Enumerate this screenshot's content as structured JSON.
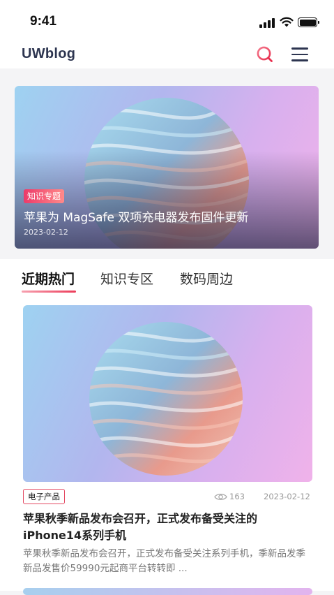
{
  "status_bar": {
    "time": "9:41"
  },
  "header": {
    "logo": "UWblog"
  },
  "hero": {
    "tag": "知识专题",
    "title": "苹果为 MagSafe 双项充电器发布固件更新",
    "date": "2023-02-12"
  },
  "tabs": [
    {
      "label": "近期热门",
      "active": true
    },
    {
      "label": "知识专区",
      "active": false
    },
    {
      "label": "数码周边",
      "active": false
    }
  ],
  "article": {
    "category": "电子产品",
    "views": "163",
    "date": "2023-02-12",
    "title": "苹果秋季新品发布会召开，正式发布备受关注的iPhone14系列手机",
    "summary": "苹果秋季新品发布会召开，正式发布备受关注系列手机，季新品发季新品发售价59990元起商平台转转即 ..."
  },
  "colors": {
    "accent": "#ec3d5a",
    "brand": "#2d3550"
  },
  "icons": [
    "signal-icon",
    "wifi-icon",
    "battery-icon",
    "search-icon",
    "menu-icon",
    "eye-icon"
  ]
}
